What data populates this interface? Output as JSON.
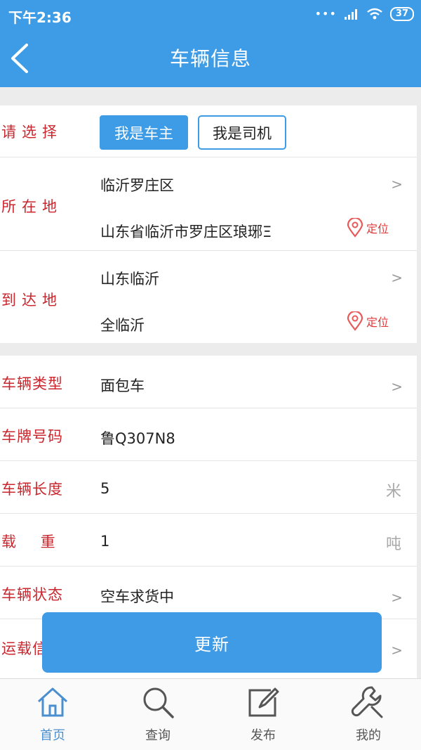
{
  "status": {
    "time": "下午2:36",
    "dots": "•••",
    "battery": "37"
  },
  "nav": {
    "title": "车辆信息"
  },
  "select": {
    "label": "请选择",
    "owner": "我是车主",
    "driver": "我是司机"
  },
  "origin": {
    "label": "所在地",
    "region": "临沂罗庄区",
    "address": "山东省临沂市罗庄区琅琊Ξ",
    "locate": "定位"
  },
  "dest": {
    "label": "到达地",
    "region": "山东临沂",
    "address": "全临沂",
    "locate": "定位"
  },
  "vehicle": {
    "type": {
      "label": "车辆类型",
      "value": "面包车"
    },
    "plate": {
      "label": "车牌号码",
      "value": "鲁Q307N8"
    },
    "length": {
      "label": "车辆长度",
      "value": "5",
      "unit": "米"
    },
    "load": {
      "label": "载 重",
      "value": "1",
      "unit": "吨"
    },
    "status": {
      "label": "车辆状态",
      "value": "空车求货中"
    },
    "transport": {
      "label": "运载信"
    }
  },
  "update_button": "更新",
  "tabs": [
    {
      "label": "首页",
      "icon": "home-icon"
    },
    {
      "label": "查询",
      "icon": "search-icon"
    },
    {
      "label": "发布",
      "icon": "edit-icon"
    },
    {
      "label": "我的",
      "icon": "wrench-icon"
    }
  ],
  "colors": {
    "accent": "#3d9ce5",
    "label_red": "#c9262d",
    "tab_active": "#4a8fcf"
  }
}
